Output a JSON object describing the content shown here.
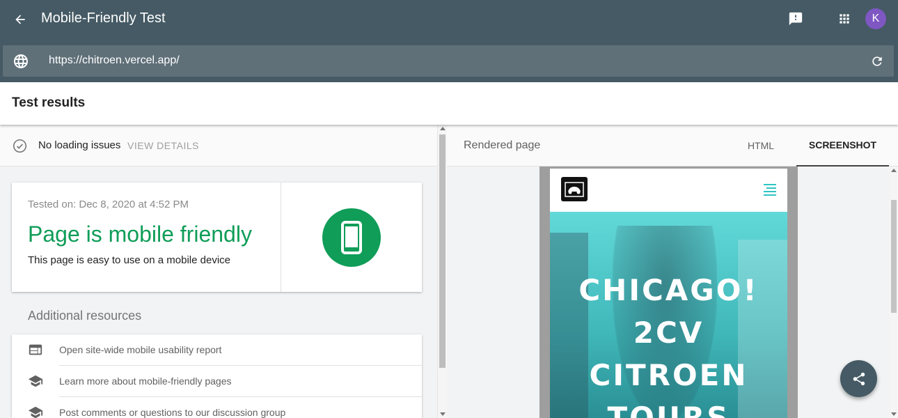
{
  "header": {
    "title": "Mobile-Friendly Test",
    "back_icon": "arrow-back-icon",
    "feedback_icon": "feedback-icon",
    "apps_icon": "apps-grid-icon",
    "avatar_initial": "K",
    "avatar_color": "#7e57c2",
    "background": "#455a64"
  },
  "url_bar": {
    "url": "https://chitroen.vercel.app/",
    "globe_icon": "globe-icon",
    "reload_icon": "reload-icon"
  },
  "section": {
    "title": "Test results"
  },
  "status": {
    "text": "No loading issues",
    "action": "VIEW DETAILS",
    "icon": "check-circle-icon"
  },
  "result": {
    "tested_on": "Tested on: Dec 8, 2020 at 4:52 PM",
    "heading": "Page is mobile friendly",
    "subtext": "This page is easy to use on a mobile device",
    "color": "#0f9d58",
    "icon": "smartphone-icon"
  },
  "resources": {
    "title": "Additional resources",
    "items": [
      {
        "label": "Open site-wide mobile usability report",
        "icon": "web-window-icon"
      },
      {
        "label": "Learn more about mobile-friendly pages",
        "icon": "school-icon"
      },
      {
        "label": "Post comments or questions to our discussion group",
        "icon": "school-icon"
      }
    ]
  },
  "rendered": {
    "label": "Rendered page",
    "tabs": [
      {
        "label": "HTML",
        "active": false
      },
      {
        "label": "SCREENSHOT",
        "active": true
      }
    ]
  },
  "preview": {
    "hero_lines": [
      "CHICAGO!",
      "2CV",
      "CITROEN",
      "TOURS"
    ],
    "accent": "#2ec4c4"
  },
  "fab": {
    "icon": "share-icon"
  }
}
